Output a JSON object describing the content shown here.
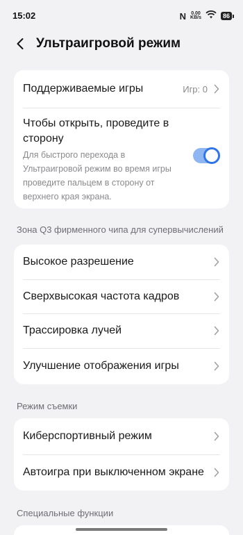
{
  "status_bar": {
    "time": "15:02",
    "nfc": "N",
    "speed_value": "0.00",
    "speed_unit": "KB/s",
    "battery": "86"
  },
  "header": {
    "title": "Ультраигровой режим"
  },
  "card1": {
    "supported_games_label": "Поддерживаемые игры",
    "supported_games_value": "Игр: 0",
    "swipe_title": "Чтобы открыть, проведите в сторону",
    "swipe_description": "Для быстрого перехода в Ультраигровой режим во время игры проведите пальцем в сторону от верхнего края экрана.",
    "swipe_toggle_on": true
  },
  "section_q3": {
    "title": "Зона Q3 фирменного чипа для супервычислений",
    "items": [
      {
        "label": "Высокое разрешение"
      },
      {
        "label": "Сверхвысокая частота кадров"
      },
      {
        "label": "Трассировка лучей"
      },
      {
        "label": "Улучшение отображения игры"
      }
    ]
  },
  "section_shooting": {
    "title": "Режим съемки",
    "items": [
      {
        "label": "Киберспортивный режим"
      },
      {
        "label": "Автоигра при выключенном экране"
      }
    ]
  },
  "section_special": {
    "title": "Специальные функции"
  },
  "colors": {
    "accent": "#2F74E8",
    "background": "#F2F2F4",
    "card": "#FFFFFF"
  }
}
